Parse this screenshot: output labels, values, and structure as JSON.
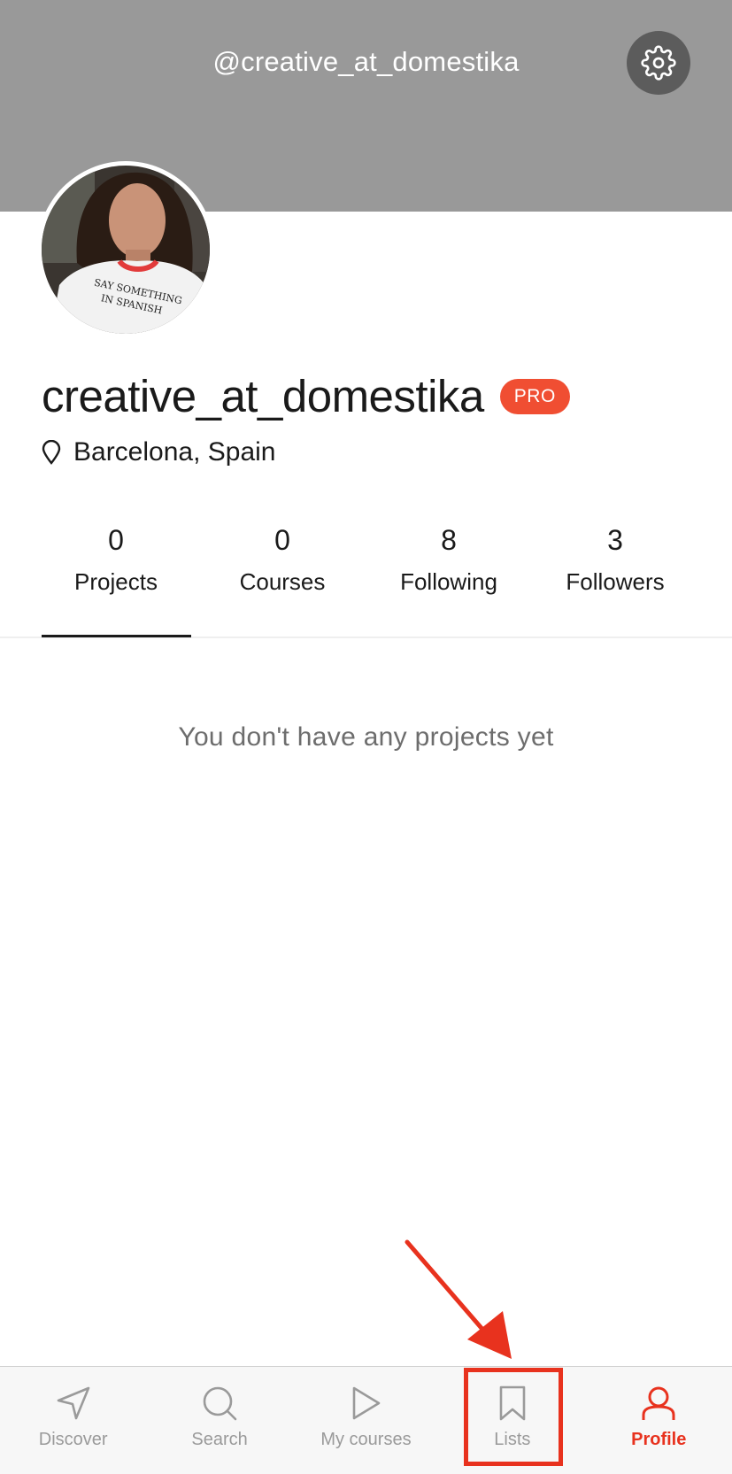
{
  "header": {
    "handle": "@creative_at_domestika",
    "settings_icon": "gear-icon"
  },
  "profile": {
    "username": "creative_at_domestika",
    "badge": "PRO",
    "location": "Barcelona, Spain",
    "avatar_shirt_text_line1": "SAY SOMETHING",
    "avatar_shirt_text_line2": "IN SPANISH"
  },
  "stats": [
    {
      "value": "0",
      "label": "Projects"
    },
    {
      "value": "0",
      "label": "Courses"
    },
    {
      "value": "8",
      "label": "Following"
    },
    {
      "value": "3",
      "label": "Followers"
    }
  ],
  "empty_message": "You don't have any projects yet",
  "bottom_nav": [
    {
      "label": "Discover",
      "icon": "send-arrow-icon"
    },
    {
      "label": "Search",
      "icon": "search-icon"
    },
    {
      "label": "My courses",
      "icon": "play-icon"
    },
    {
      "label": "Lists",
      "icon": "bookmark-icon"
    },
    {
      "label": "Profile",
      "icon": "user-icon"
    }
  ],
  "colors": {
    "header_bg": "#999999",
    "accent": "#e8321e",
    "badge_bg": "#f04e32",
    "nav_inactive": "#9a9a9a"
  }
}
